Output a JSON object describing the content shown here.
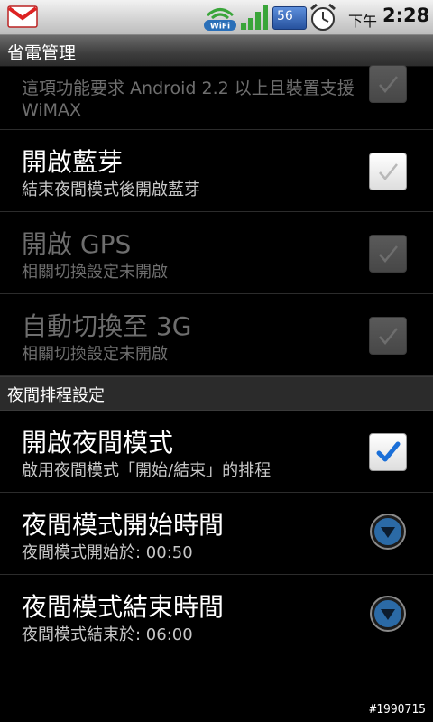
{
  "status_bar": {
    "battery_level": "56",
    "ampm": "下午",
    "time": "2:28"
  },
  "title": "省電管理",
  "items": [
    {
      "title": "",
      "summary": "這項功能要求 Android 2.2 以上且裝置支援 WiMAX",
      "checked": true,
      "enabled": false
    },
    {
      "title": "開啟藍芽",
      "summary": "結束夜間模式後開啟藍芽",
      "checked": true,
      "enabled": true
    },
    {
      "title": "開啟 GPS",
      "summary": "相關切換設定未開啟",
      "checked": true,
      "enabled": false
    },
    {
      "title": "自動切換至 3G",
      "summary": "相關切換設定未開啟",
      "checked": true,
      "enabled": false
    }
  ],
  "section": {
    "title": "夜間排程設定"
  },
  "schedule": [
    {
      "title": "開啟夜間模式",
      "summary": "啟用夜間模式「開始/結束」的排程",
      "checked": true
    },
    {
      "title": "夜間模式開始時間",
      "summary": "夜間模式開始於: 00:50"
    },
    {
      "title": "夜間模式結束時間",
      "summary": "夜間模式結束於: 06:00"
    }
  ],
  "watermark": "#1990715"
}
